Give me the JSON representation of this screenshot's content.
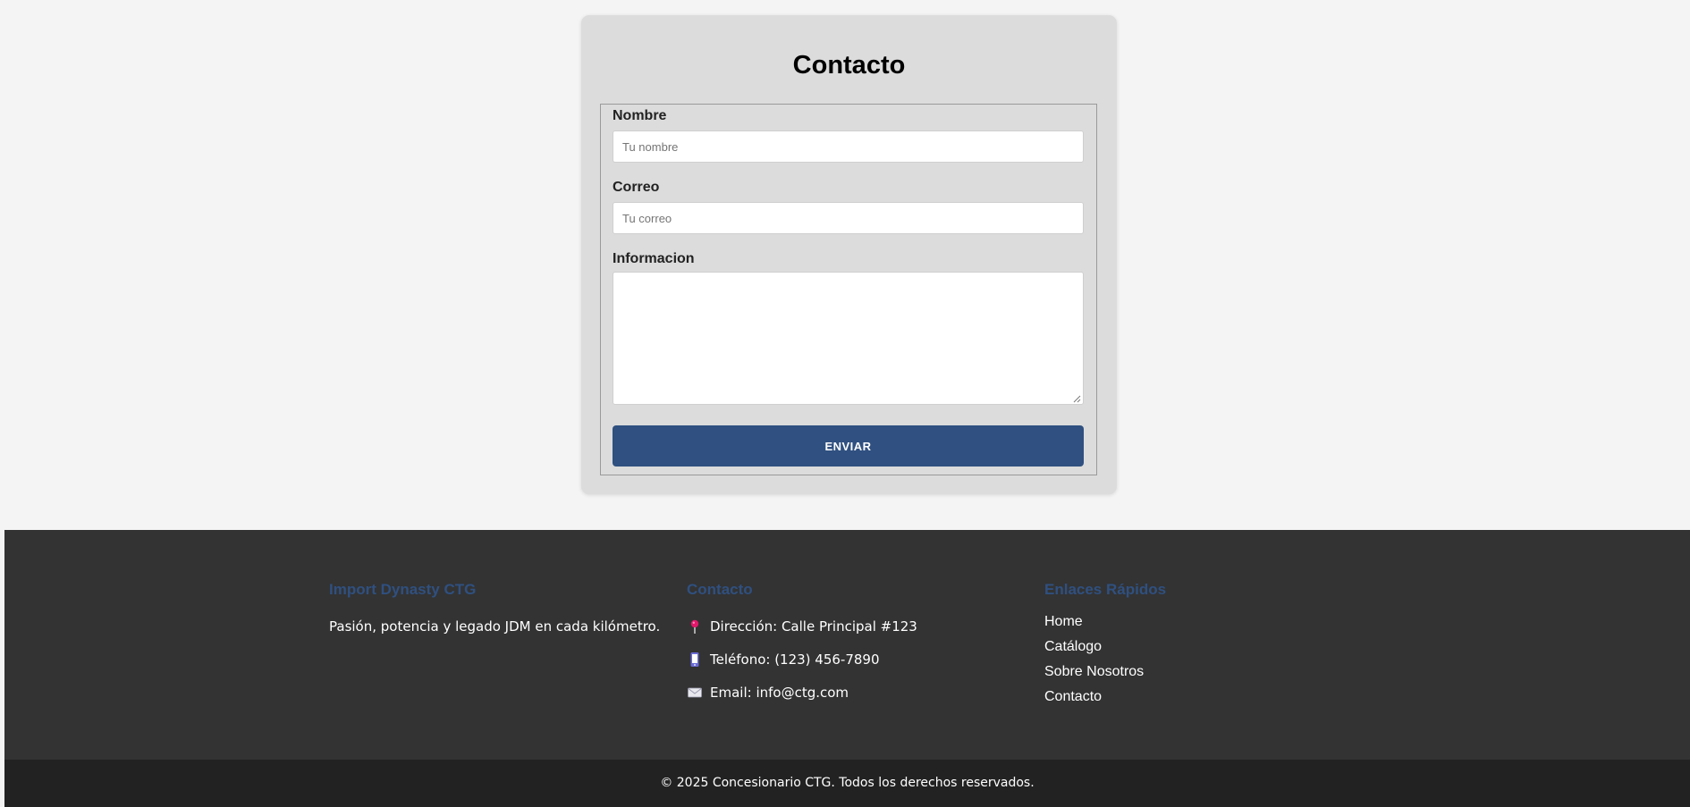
{
  "contact_form": {
    "title": "Contacto",
    "name_label": "Nombre",
    "name_placeholder": "Tu nombre",
    "name_value": "",
    "email_label": "Correo",
    "email_placeholder": "Tu correo",
    "email_value": "",
    "info_label": "Informacion",
    "info_value": "",
    "submit_label": "ENVIAR"
  },
  "footer": {
    "brand_title": "Import Dynasty CTG",
    "tagline": "Pasión, potencia y legado JDM en cada kilómetro.",
    "contact_title": "Contacto",
    "address": "Dirección: Calle Principal #123",
    "phone": "Teléfono: (123) 456-7890",
    "email": "Email: info@ctg.com",
    "contact_icons": [
      "pin-icon",
      "phone-icon",
      "envelope-icon"
    ],
    "links_title": "Enlaces Rápidos",
    "links": [
      "Home",
      "Catálogo",
      "Sobre Nosotros",
      "Contacto"
    ],
    "copyright": "© 2025 Concesionario CTG. Todos los derechos reservados."
  },
  "colors": {
    "page_background": "#f4f4f4",
    "card_background": "#dcdcdc",
    "accent": "#2f5080",
    "footer_background": "#333333",
    "footer_bottom_background": "#222222"
  }
}
